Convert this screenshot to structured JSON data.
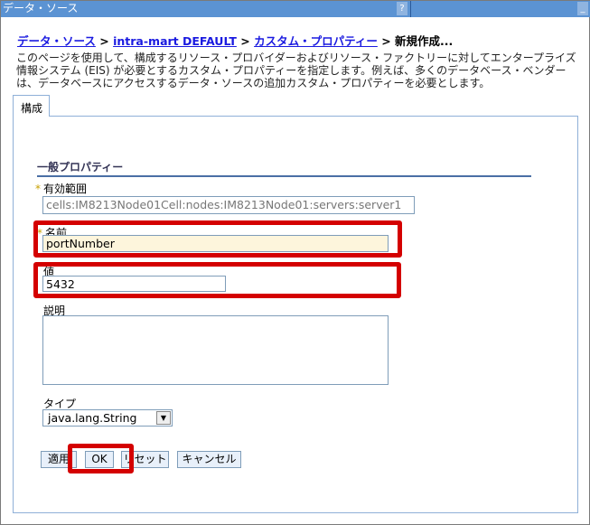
{
  "window": {
    "title": "データ・ソース",
    "help": "?",
    "minimize": "_"
  },
  "breadcrumb": {
    "items": [
      "データ・ソース",
      "intra-mart DEFAULT",
      "カスタム・プロパティー"
    ],
    "separator": ">",
    "current": "新規作成..."
  },
  "description": "このページを使用して、構成するリソース・プロバイダーおよびリソース・ファクトリーに対してエンタープライズ情報システム (EIS) が必要とするカスタム・プロパティーを指定します。例えば、多くのデータベース・ベンダーは、データベースにアクセスするデータ・ソースの追加カスタム・プロパティーを必要とします。",
  "tabs": [
    {
      "label": "構成"
    }
  ],
  "form": {
    "section": "一般プロパティー",
    "required_mark": "*",
    "scope": {
      "label": "有効範囲",
      "value": "cells:IM8213Node01Cell:nodes:IM8213Node01:servers:server1"
    },
    "name": {
      "label": "名前",
      "value": "portNumber"
    },
    "value": {
      "label": "値",
      "value": "5432"
    },
    "description": {
      "label": "説明",
      "value": ""
    },
    "type": {
      "label": "タイプ",
      "value": "java.lang.String"
    }
  },
  "buttons": {
    "apply": "適用",
    "ok": "OK",
    "reset": "リセット",
    "cancel": "キャンセル"
  },
  "colors": {
    "highlight": "#d40000",
    "titlebar": "#5b93d3"
  }
}
